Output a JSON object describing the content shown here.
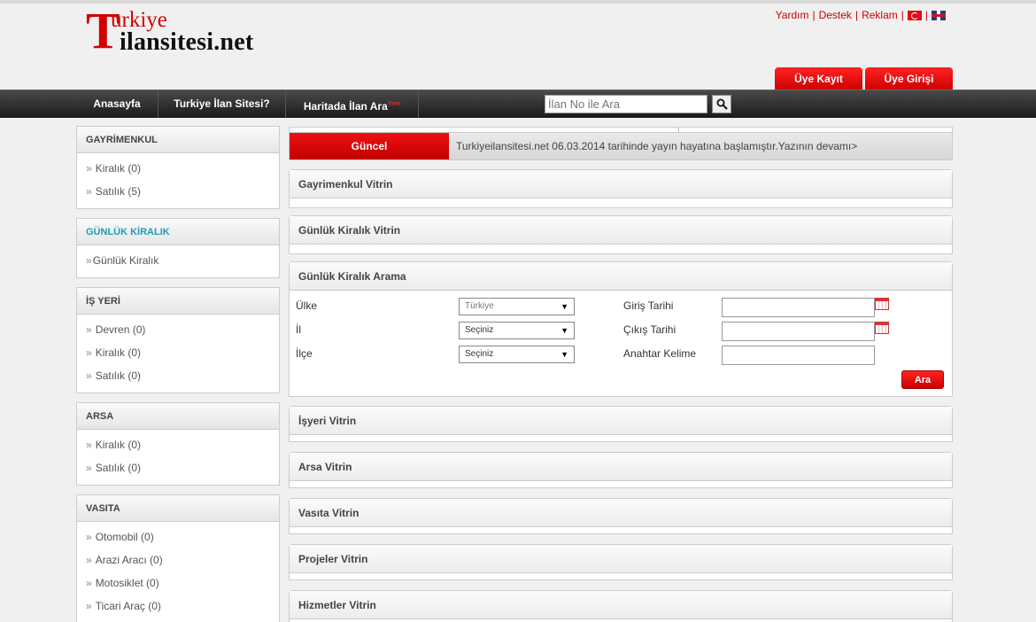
{
  "logo": {
    "big_letter": "T",
    "line1": "urkiye",
    "line2": "ilansitesi.net"
  },
  "toplinks": {
    "help": "Yardım",
    "support": "Destek",
    "ads": "Reklam",
    "sep": "|"
  },
  "member": {
    "register": "Üye Kayıt",
    "login": "Üye Girişi"
  },
  "nav": {
    "items": [
      {
        "label": "Anasayfa"
      },
      {
        "label": "Turkiye İlan Sitesi?"
      },
      {
        "label": "Haritada İlan Ara",
        "badge": "Yeni"
      }
    ],
    "search_placeholder": "İlan No ile Ara"
  },
  "sidebar": {
    "boxes": [
      {
        "title": "GAYRİMENKUL",
        "items": [
          "Kiralık (0)",
          "Satılık (5)"
        ]
      },
      {
        "title": "GÜNLÜK KİRALIK",
        "items": [
          "Günlük Kiralık"
        ]
      },
      {
        "title": "İŞ YERİ",
        "items": [
          "Devren (0)",
          "Kiralık (0)",
          "Satılık (0)"
        ]
      },
      {
        "title": "ARSA",
        "items": [
          "Kiralık (0)",
          "Satılık (0)"
        ]
      },
      {
        "title": "VASITA",
        "items": [
          "Otomobil (0)",
          "Arazi Aracı (0)",
          "Motosiklet (0)",
          "Ticari Araç (0)"
        ]
      }
    ]
  },
  "ticker": {
    "label": "Güncel",
    "text": "Turkiyeilansitesi.net 06.03.2014 tarihinde yayın hayatına başlamıştır.Yazının devamı>"
  },
  "panels": {
    "gayrimenkul": "Gayrimenkul Vitrin",
    "gunluk": "Günlük Kiralık Vitrin",
    "arama": "Günlük Kiralık Arama",
    "isyeri": "İşyeri Vitrin",
    "arsa": "Arsa Vitrin",
    "vasita": "Vasıta Vitrin",
    "projeler": "Projeler Vitrin",
    "hizmetler": "Hizmetler Vitrin"
  },
  "search_form": {
    "country_label": "Ülke",
    "country_value": "Türkiye",
    "city_label": "İl",
    "city_value": "Seçiniz",
    "district_label": "İlçe",
    "district_value": "Seçiniz",
    "checkin_label": "Giriş Tarihi",
    "checkout_label": "Çıkış Tarihi",
    "keyword_label": "Anahtar Kelime",
    "submit": "Ara"
  },
  "colors": {
    "accent": "#d40000",
    "teal": "#1f9cb4",
    "nav_dark": "#1a1a1a"
  }
}
